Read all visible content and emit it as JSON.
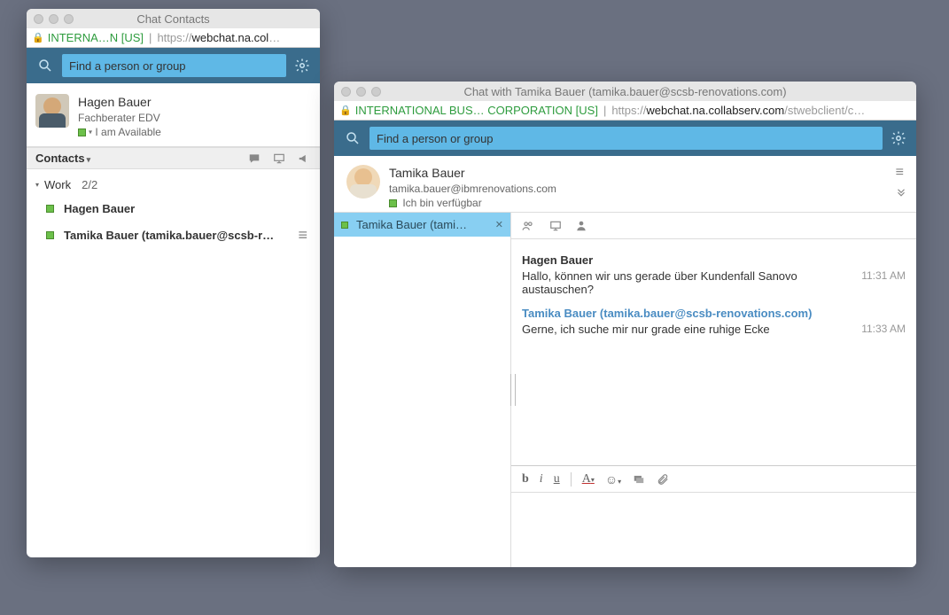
{
  "contacts_window": {
    "title": "Chat Contacts",
    "cert": "INTERNA…N [US]",
    "url_dim1": "https://",
    "url_bold": "webchat.na.col",
    "url_trail": "…",
    "search_placeholder": "Find a person or group",
    "me": {
      "name": "Hagen Bauer",
      "subtitle": "Fachberater EDV",
      "status": "I am Available"
    },
    "section_label": "Contacts",
    "work_group": {
      "label": "Work",
      "count": "2/2"
    },
    "items": [
      {
        "name": "Hagen Bauer"
      },
      {
        "name": "Tamika Bauer (tamika.bauer@scsb-r…"
      }
    ]
  },
  "chat_window": {
    "title": "Chat with Tamika Bauer (tamika.bauer@scsb-renovations.com)",
    "cert": "INTERNATIONAL BUS… CORPORATION [US]",
    "url_dim1": "https://",
    "url_bold": "webchat.na.collabserv.com",
    "url_trail": "/stwebclient/c…",
    "search_placeholder": "Find a person or group",
    "partner": {
      "name": "Tamika Bauer",
      "email": "tamika.bauer@ibmrenovations.com",
      "status": "Ich bin verfügbar"
    },
    "tab_label": "Tamika Bauer (tami…",
    "messages": [
      {
        "sender": "Hagen Bauer",
        "sender_class": "",
        "text": "Hallo, können wir uns gerade über Kundenfall Sanovo austauschen?",
        "time": "11:31 AM"
      },
      {
        "sender": "Tamika Bauer (tamika.bauer@scsb-renovations.com)",
        "sender_class": "blue",
        "text": "Gerne, ich suche mir nur grade eine ruhige Ecke",
        "time": "11:33 AM"
      }
    ]
  }
}
